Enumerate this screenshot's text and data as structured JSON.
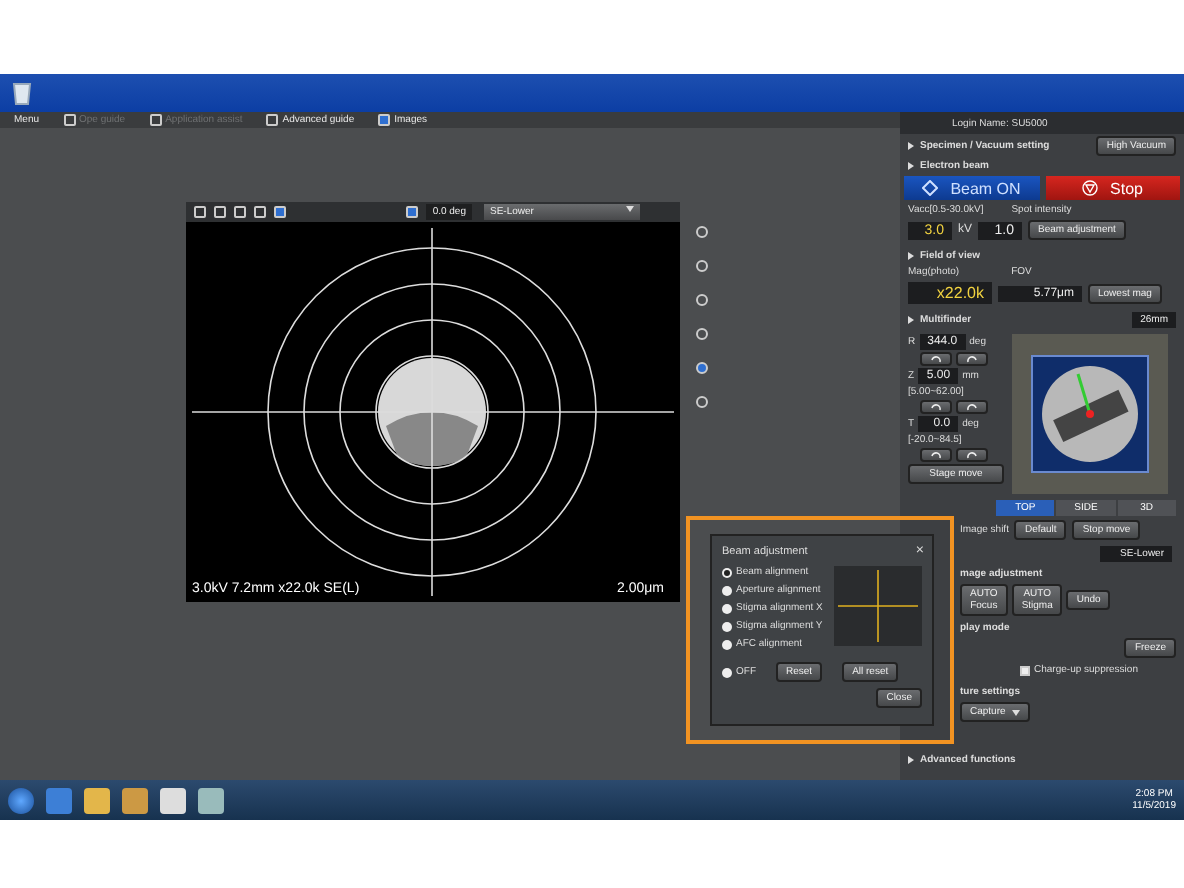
{
  "menu_bar": {
    "items": [
      {
        "label": "Menu",
        "disabled": false
      },
      {
        "label": "Ope guide",
        "disabled": true
      },
      {
        "label": "Application assist",
        "disabled": true
      },
      {
        "label": "Advanced guide",
        "disabled": false
      },
      {
        "label": "Images",
        "disabled": false
      }
    ]
  },
  "image_toolbar": {
    "rotation": "0.0 deg",
    "detector": "SE-Lower"
  },
  "image": {
    "info": "3.0kV 7.2mm x22.0k SE(L)",
    "scale": "2.00μm"
  },
  "panel": {
    "login": "Login Name: SU5000",
    "specimen": {
      "title": "Specimen / Vacuum setting",
      "vacuum": "High Vacuum"
    },
    "beam": {
      "title": "Electron beam",
      "on_label": "Beam ON",
      "stop_label": "Stop",
      "vacc_label": "Vacc[0.5-30.0kV]",
      "vacc": "3.0",
      "vacc_unit": "kV",
      "spot_label": "Spot intensity",
      "spot": "1.0",
      "adjust": "Beam adjustment"
    },
    "field_of_view": {
      "title": "Field of view",
      "mag_label": "Mag(photo)",
      "mag": "x22.0k",
      "fov_label": "FOV",
      "fov": "5.77μm",
      "lowest": "Lowest mag"
    },
    "multifinder": {
      "title": "Multifinder",
      "size": "26mm",
      "axes": [
        {
          "name": "R",
          "value": "344.0",
          "unit": "deg"
        },
        {
          "name": "Z",
          "value": "5.00",
          "unit": "mm",
          "range": "[5.00~62.00]"
        },
        {
          "name": "T",
          "value": "0.0",
          "unit": "deg",
          "range": "[-20.0~84.5]"
        }
      ],
      "stage_move": "Stage move",
      "views": [
        {
          "label": "TOP",
          "selected": true
        },
        {
          "label": "SIDE",
          "selected": false
        },
        {
          "label": "3D",
          "selected": false
        }
      ]
    },
    "image_shift": "Image shift",
    "default": "Default",
    "stop_move": "Stop move",
    "detector": "SE-Lower",
    "image_adjustment": {
      "title": "mage adjustment",
      "buttons": [
        {
          "lines": [
            "AUTO",
            "Focus"
          ]
        },
        {
          "lines": [
            "AUTO",
            "Stigma"
          ]
        },
        {
          "lines": [
            "Undo"
          ]
        }
      ]
    },
    "display": {
      "title": "play mode",
      "freeze": "Freeze"
    },
    "charge_up": {
      "label": "Charge-up suppression",
      "checked": false
    },
    "capture": {
      "title": "ture settings",
      "mode": "Capture"
    },
    "advanced": "Advanced functions"
  },
  "dialog": {
    "title": "Beam adjustment",
    "close": "×",
    "options": [
      {
        "label": "Beam alignment",
        "selected": true
      },
      {
        "label": "Aperture alignment",
        "selected": false
      },
      {
        "label": "Stigma alignment X",
        "selected": false
      },
      {
        "label": "Stigma alignment Y",
        "selected": false
      },
      {
        "label": "AFC alignment",
        "selected": false
      }
    ],
    "off": {
      "label": "OFF",
      "selected": false
    },
    "buttons": [
      "Reset",
      "All reset",
      "Close"
    ]
  },
  "taskbar": {
    "time": "2:08 PM",
    "date": "11/5/2019"
  }
}
